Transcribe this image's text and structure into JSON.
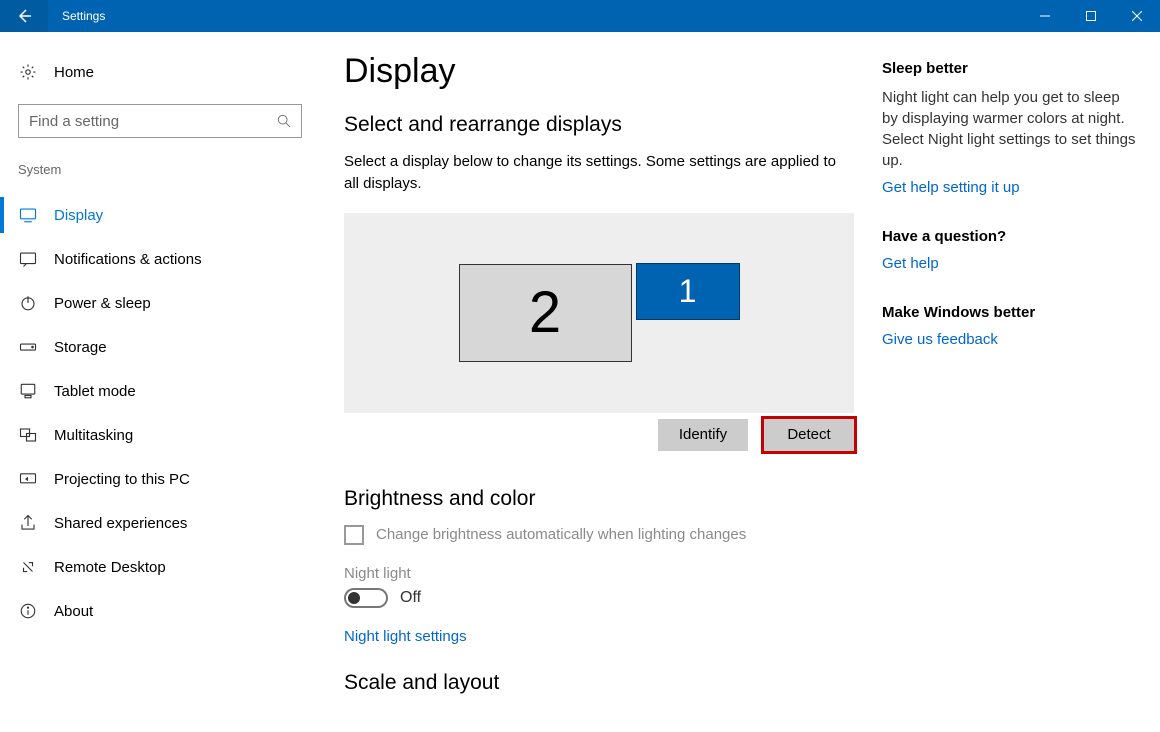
{
  "titlebar": {
    "title": "Settings"
  },
  "sidebar": {
    "home_label": "Home",
    "search_placeholder": "Find a setting",
    "section_label": "System",
    "items": [
      {
        "label": "Display"
      },
      {
        "label": "Notifications & actions"
      },
      {
        "label": "Power & sleep"
      },
      {
        "label": "Storage"
      },
      {
        "label": "Tablet mode"
      },
      {
        "label": "Multitasking"
      },
      {
        "label": "Projecting to this PC"
      },
      {
        "label": "Shared experiences"
      },
      {
        "label": "Remote Desktop"
      },
      {
        "label": "About"
      }
    ]
  },
  "main": {
    "heading": "Display",
    "rearrange_heading": "Select and rearrange displays",
    "rearrange_desc": "Select a display below to change its settings. Some settings are applied to all displays.",
    "monitor2": "2",
    "monitor1": "1",
    "identify_btn": "Identify",
    "detect_btn": "Detect",
    "brightness_heading": "Brightness and color",
    "auto_brightness_label": "Change brightness automatically when lighting changes",
    "night_light_label": "Night light",
    "night_light_state": "Off",
    "night_light_link": "Night light settings",
    "scale_heading": "Scale and layout"
  },
  "info": {
    "sleep_heading": "Sleep better",
    "sleep_text": "Night light can help you get to sleep by displaying warmer colors at night. Select Night light settings to set things up.",
    "sleep_link": "Get help setting it up",
    "question_heading": "Have a question?",
    "question_link": "Get help",
    "feedback_heading": "Make Windows better",
    "feedback_link": "Give us feedback"
  }
}
